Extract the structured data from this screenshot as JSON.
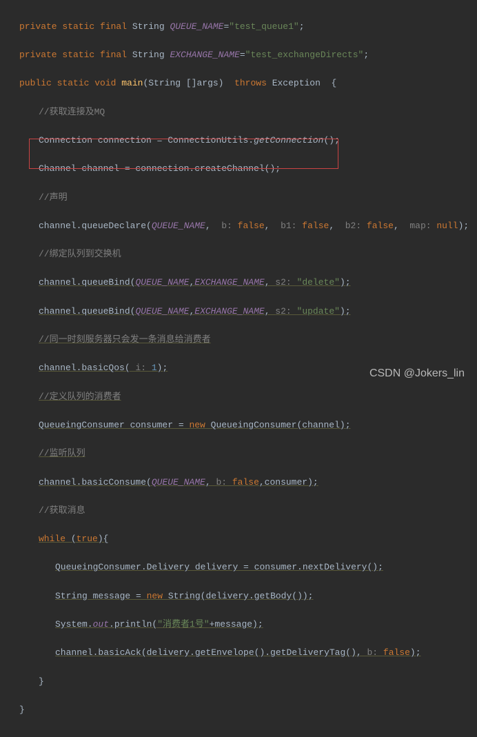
{
  "code": {
    "l1": {
      "kw1": "private static final ",
      "type": "String ",
      "const": "QUEUE_NAME",
      "eq": "=",
      "str": "\"test_queue1\"",
      "semi": ";"
    },
    "l2": {
      "kw1": "private static final ",
      "type": "String ",
      "const": "EXCHANGE_NAME",
      "eq": "=",
      "str": "\"test_exchangeDirects\"",
      "semi": ";"
    },
    "l3": {
      "kw1": "public static ",
      "kw2": "void ",
      "method": "main",
      "params": "(String []args)  ",
      "kw3": "throws ",
      "exc": "Exception  {"
    },
    "l4": {
      "comment": "//获取连接及MQ"
    },
    "l5": {
      "t1": "Connection connection = ConnectionUtils.",
      "m": "getConnection",
      "t2": "();"
    },
    "l6": {
      "t1": "Channel channel = connection.createChannel();"
    },
    "l7": {
      "comment": "//声明"
    },
    "l8": {
      "t1": "channel.queueDeclare(",
      "c1": "QUEUE_NAME",
      "t2": ",  ",
      "p1": "b: ",
      "kw1": "false",
      "t3": ",  ",
      "p2": "b1: ",
      "kw2": "false",
      "t4": ",  ",
      "p3": "b2: ",
      "kw3": "false",
      "t5": ",  ",
      "p4": "map: ",
      "kw4": "null",
      "t6": ");"
    },
    "l9": {
      "comment": "//绑定队列到交换机"
    },
    "l10": {
      "t1": "channel.queueBind(",
      "c1": "QUEUE_NAME",
      "t2": ",",
      "c2": "EXCHANGE_NAME",
      "t3": ", ",
      "p1": "s2: ",
      "str": "\"delete\"",
      "t4": ");"
    },
    "l11": {
      "t1": "channel.queueBind(",
      "c1": "QUEUE_NAME",
      "t2": ",",
      "c2": "EXCHANGE_NAME",
      "t3": ", ",
      "p1": "s2: ",
      "str": "\"update\"",
      "t4": ");"
    },
    "l12": {
      "comment": "//同一时刻服务器只会发一条消息给消费者"
    },
    "l13": {
      "t1": "channel.basicQos( ",
      "p1": "i: ",
      "n": "1",
      "t2": ");"
    },
    "l14": {
      "comment": "//定义队列的消费者"
    },
    "l15": {
      "t1": "QueueingConsumer consumer = ",
      "kw": "new ",
      "t2": "QueueingConsumer(channel);"
    },
    "l16": {
      "comment": "//监听队列"
    },
    "l17": {
      "t1": "channel.basicConsume(",
      "c1": "QUEUE_NAME",
      "t2": ", ",
      "p1": "b: ",
      "kw": "false",
      "t3": ",consumer);"
    },
    "l18": {
      "comment": "//获取消息"
    },
    "l19": {
      "kw1": "while ",
      "t1": "(",
      "kw2": "true",
      "t2": "){"
    },
    "l20": {
      "t1": "QueueingConsumer.Delivery delivery = consumer.nextDelivery();"
    },
    "l21": {
      "t1": "String message = ",
      "kw": "new ",
      "t2": "String(delivery.getBody());"
    },
    "l22": {
      "t1": "System.",
      "c1": "out",
      "t2": ".println(",
      "str": "\"消费者1号\"",
      "t3": "+message);"
    },
    "l23": {
      "t1": "channel.basicAck(delivery.getEnvelope().getDeliveryTag(), ",
      "p1": "b: ",
      "kw": "false",
      "t2": ");"
    },
    "l24": {
      "t1": "}"
    },
    "l25": {
      "t1": "}"
    }
  },
  "watermark": "CSDN @Jokers_lin"
}
